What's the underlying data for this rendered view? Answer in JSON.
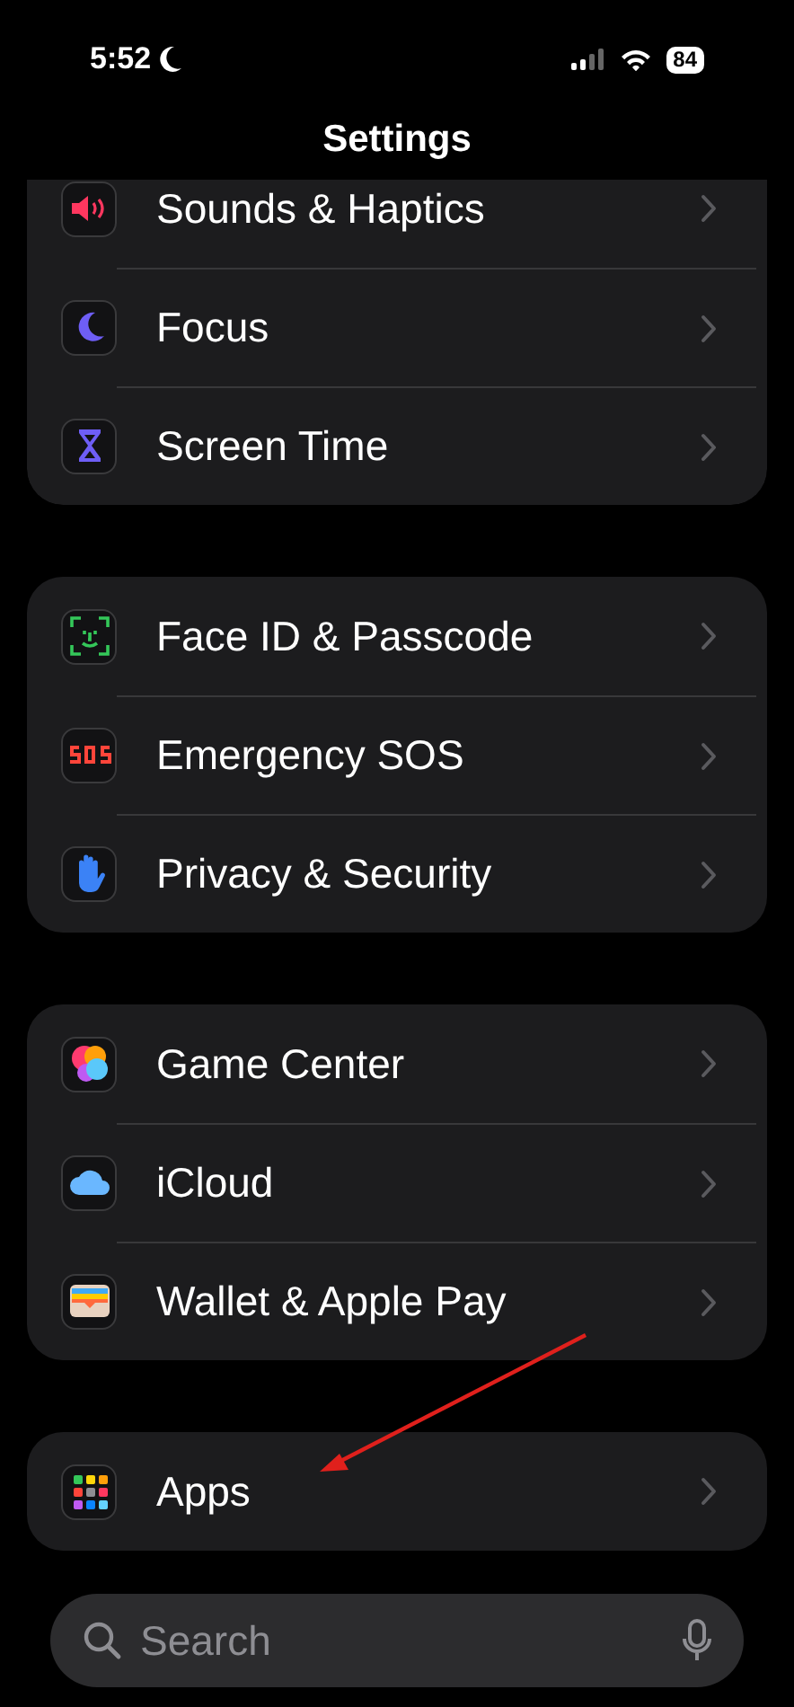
{
  "status_bar": {
    "time": "5:52",
    "battery": "84"
  },
  "title": "Settings",
  "groups": [
    {
      "items": [
        {
          "label": "Sounds & Haptics"
        },
        {
          "label": "Focus"
        },
        {
          "label": "Screen Time"
        }
      ]
    },
    {
      "items": [
        {
          "label": "Face ID & Passcode"
        },
        {
          "label": "Emergency SOS"
        },
        {
          "label": "Privacy & Security"
        }
      ]
    },
    {
      "items": [
        {
          "label": "Game Center"
        },
        {
          "label": "iCloud"
        },
        {
          "label": "Wallet & Apple Pay"
        }
      ]
    },
    {
      "items": [
        {
          "label": "Apps"
        }
      ]
    }
  ],
  "search": {
    "placeholder": "Search"
  }
}
